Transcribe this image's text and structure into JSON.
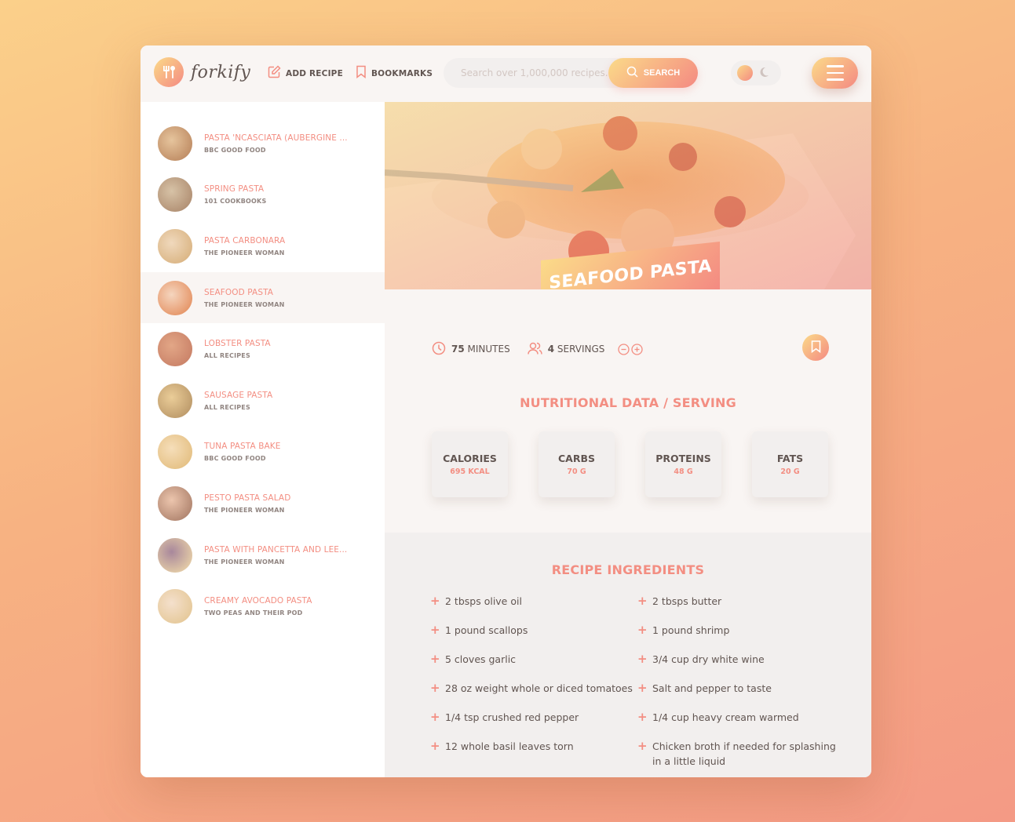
{
  "header": {
    "logo_text": "forkify",
    "nav": [
      {
        "label": "ADD RECIPE",
        "icon": "edit-icon"
      },
      {
        "label": "BOOKMARKS",
        "icon": "bookmark-icon"
      }
    ],
    "search": {
      "placeholder": "Search over 1,000,000 recipes...",
      "value": "",
      "button_label": "SEARCH"
    },
    "theme_toggle": {
      "active": "light"
    },
    "menu_icon": "hamburger-icon"
  },
  "sidebar": {
    "results": [
      {
        "title": "PASTA 'NCASCIATA (AUBERGINE ...",
        "publisher": "BBC GOOD FOOD",
        "thumb_colors": [
          "#a0663a",
          "#d9b88c"
        ],
        "active": false
      },
      {
        "title": "SPRING PASTA",
        "publisher": "101 COOKBOOKS",
        "thumb_colors": [
          "#8a6a50",
          "#c2b59b"
        ],
        "active": false
      },
      {
        "title": "PASTA CARBONARA",
        "publisher": "THE PIONEER WOMAN",
        "thumb_colors": [
          "#c9a36a",
          "#e8d7bd"
        ],
        "active": false
      },
      {
        "title": "SEAFOOD PASTA",
        "publisher": "THE PIONEER WOMAN",
        "thumb_colors": [
          "#d9733f",
          "#f0d2c0"
        ],
        "active": true
      },
      {
        "title": "LOBSTER PASTA",
        "publisher": "ALL RECIPES",
        "thumb_colors": [
          "#b0553e",
          "#d38a6a"
        ],
        "active": false
      },
      {
        "title": "SAUSAGE PASTA",
        "publisher": "ALL RECIPES",
        "thumb_colors": [
          "#9c7a42",
          "#e0c585"
        ],
        "active": false
      },
      {
        "title": "TUNA PASTA BAKE",
        "publisher": "BBC GOOD FOOD",
        "thumb_colors": [
          "#d8b46a",
          "#f1dfb8"
        ],
        "active": false
      },
      {
        "title": "PESTO PASTA SALAD",
        "publisher": "THE PIONEER WOMAN",
        "thumb_colors": [
          "#8a5a4a",
          "#e2b9a5"
        ],
        "active": false
      },
      {
        "title": "PASTA WITH PANCETTA AND LEE...",
        "publisher": "THE PIONEER WOMAN",
        "thumb_colors": [
          "#d4c19a",
          "#7a5a8a"
        ],
        "active": false
      },
      {
        "title": "CREAMY AVOCADO PASTA",
        "publisher": "TWO PEAS AND THEIR POD",
        "thumb_colors": [
          "#d9c08a",
          "#efe2d5"
        ],
        "active": false
      }
    ]
  },
  "recipe": {
    "title": "SEAFOOD PASTA",
    "cooking_time": "75",
    "cooking_time_unit": "MINUTES",
    "servings": "4",
    "servings_unit": "SERVINGS",
    "bookmarked": false
  },
  "nutrition": {
    "heading": "NUTRITIONAL DATA / SERVING",
    "items": [
      {
        "label": "CALORIES",
        "value": "695 KCAL"
      },
      {
        "label": "CARBS",
        "value": "70 G"
      },
      {
        "label": "PROTEINS",
        "value": "48 G"
      },
      {
        "label": "FATS",
        "value": "20 G"
      }
    ]
  },
  "ingredients": {
    "heading": "RECIPE INGREDIENTS",
    "items": [
      "2 tbsps olive oil",
      "2 tbsps butter",
      "1 pound scallops",
      "1 pound shrimp",
      "5 cloves garlic",
      "3/4 cup dry white wine",
      "28 oz weight whole or diced tomatoes",
      "Salt and pepper to taste",
      "1/4 tsp crushed red pepper",
      "1/4 cup heavy cream warmed",
      "12 whole basil leaves torn",
      "Chicken broth if needed for splashing in a little liquid"
    ]
  },
  "colors": {
    "accent": "#f38e82",
    "gradient_start": "#fbdb89",
    "gradient_end": "#f48982",
    "text": "#615551",
    "muted": "#918581"
  }
}
